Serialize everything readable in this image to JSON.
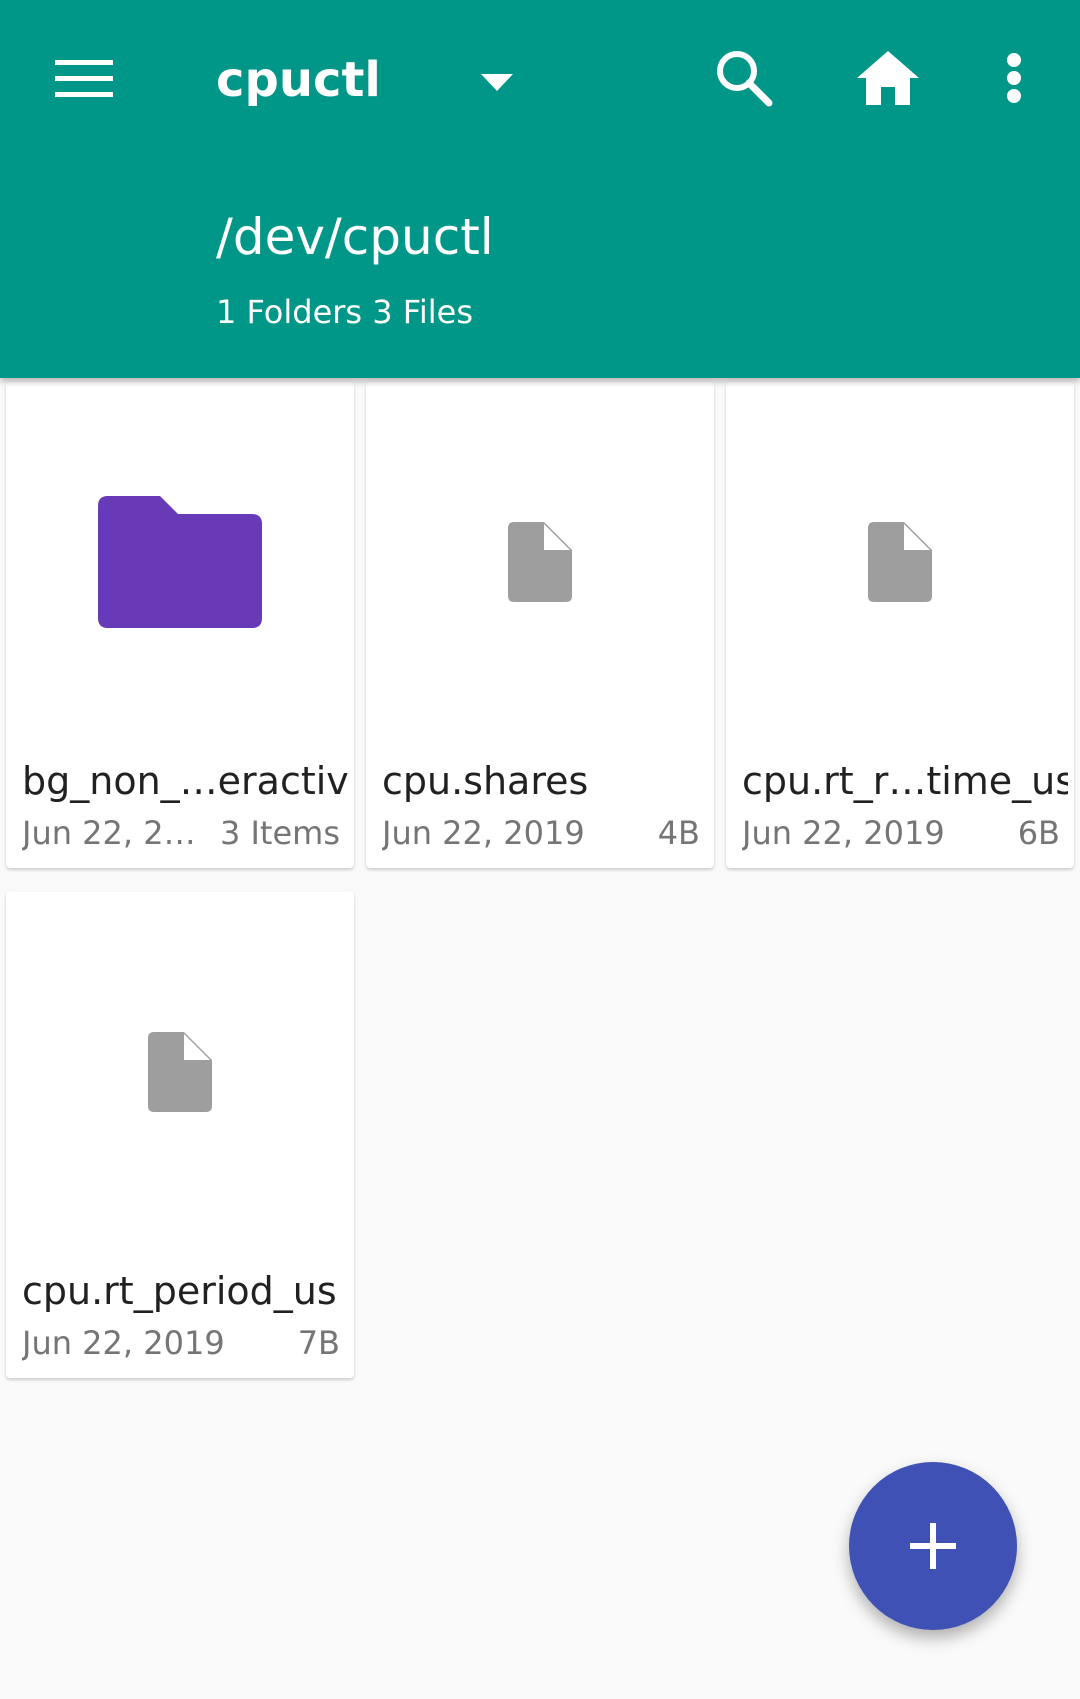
{
  "toolbar": {
    "title": "cpuctl",
    "path": "/dev/cpuctl",
    "counts": "1 Folders 3 Files"
  },
  "icons": {
    "menu": "menu-icon",
    "dropdown": "arrow-drop-down-icon",
    "search": "search-icon",
    "home": "home-icon",
    "more": "more-vert-icon",
    "folder": "folder-icon",
    "file": "file-icon",
    "add": "add-icon"
  },
  "colors": {
    "appbar": "#009688",
    "folder": "#673ab7",
    "file": "#9e9e9e",
    "fab": "#3f51b5"
  },
  "items": [
    {
      "name": "bg_non_…eractive",
      "date": "Jun 22, 2…",
      "size": "3 Items",
      "type": "folder"
    },
    {
      "name": "cpu.shares",
      "date": "Jun 22, 2019",
      "size": "4B",
      "type": "file"
    },
    {
      "name": "cpu.rt_r…time_us",
      "date": "Jun 22, 2019",
      "size": "6B",
      "type": "file"
    },
    {
      "name": "cpu.rt_period_us",
      "date": "Jun 22, 2019",
      "size": "7B",
      "type": "file"
    }
  ]
}
